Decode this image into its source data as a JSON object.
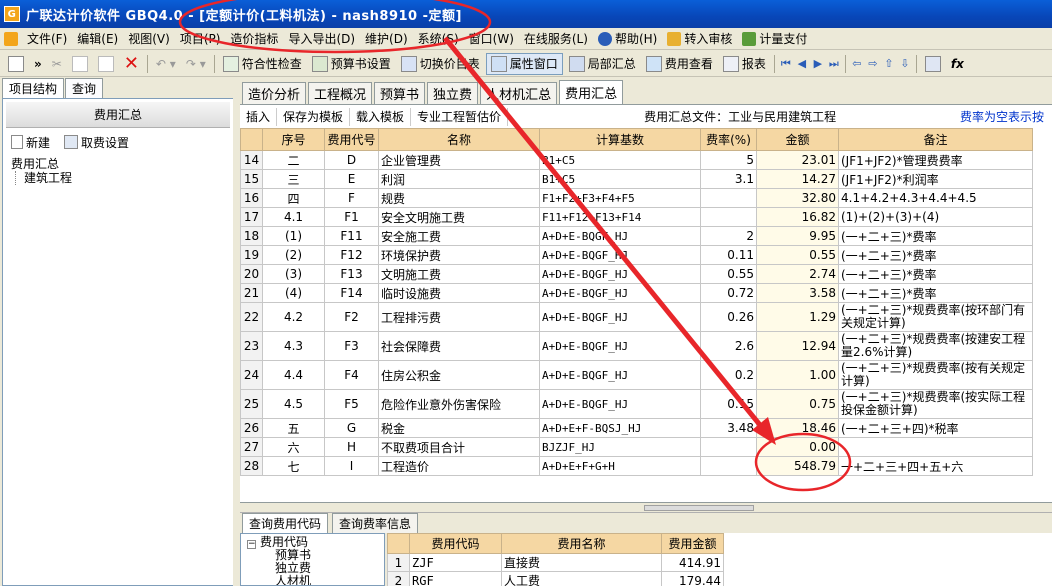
{
  "window": {
    "title": "广联达计价软件 GBQ4.0 - [定额计价(工料机法) - nash8910 -定额]",
    "app_icon": "G"
  },
  "menu": [
    "文件(F)",
    "编辑(E)",
    "视图(V)",
    "项目(P)",
    "造价指标",
    "导入导出(D)",
    "维护(D)",
    "系统(S)",
    "窗口(W)",
    "在线服务(L)",
    "帮助(H)",
    "转入审核",
    "计量支付"
  ],
  "toolbar": {
    "check": "符合性检查",
    "budget_settings": "预算书设置",
    "switch_price": "切换价目表",
    "property_window": "属性窗口",
    "partial_summary": "局部汇总",
    "fee_view": "费用查看",
    "report": "报表"
  },
  "left": {
    "tabs": [
      "项目结构",
      "查询"
    ],
    "header": "费用汇总",
    "new": "新建",
    "fee_settings": "取费设置",
    "tree_root": "费用汇总",
    "tree_child": "建筑工程"
  },
  "main_tabs": [
    "造价分析",
    "工程概况",
    "预算书",
    "独立费",
    "人材机汇总",
    "费用汇总"
  ],
  "subbar": {
    "insert": "插入",
    "save_template": "保存为模板",
    "load_template": "载入模板",
    "estimate": "专业工程暂估价",
    "file_label": "费用汇总文件：工业与民用建筑工程",
    "link": "费率为空表示按"
  },
  "grid": {
    "headers": [
      "序号",
      "费用代号",
      "名称",
      "计算基数",
      "费率(%)",
      "金额",
      "备注"
    ],
    "rows": [
      {
        "n": "14",
        "seq": "二",
        "code": "D",
        "name": "企业管理费",
        "base": "B1+C5",
        "rate": "5",
        "amt": "23.01",
        "note": "(JF1+JF2)*管理费费率"
      },
      {
        "n": "15",
        "seq": "三",
        "code": "E",
        "name": "利润",
        "base": "B1+C5",
        "rate": "3.1",
        "amt": "14.27",
        "note": "(JF1+JF2)*利润率"
      },
      {
        "n": "16",
        "seq": "四",
        "code": "F",
        "name": "规费",
        "base": "F1+F2+F3+F4+F5",
        "rate": "",
        "amt": "32.80",
        "note": "4.1+4.2+4.3+4.4+4.5"
      },
      {
        "n": "17",
        "seq": "4.1",
        "code": "F1",
        "name": "安全文明施工费",
        "base": "F11+F12+F13+F14",
        "rate": "",
        "amt": "16.82",
        "note": "(1)+(2)+(3)+(4)"
      },
      {
        "n": "18",
        "seq": "(1)",
        "code": "F11",
        "name": "安全施工费",
        "base": "A+D+E-BQGF_HJ",
        "rate": "2",
        "amt": "9.95",
        "note": "(一+二+三)*费率"
      },
      {
        "n": "19",
        "seq": "(2)",
        "code": "F12",
        "name": "环境保护费",
        "base": "A+D+E-BQGF_HJ",
        "rate": "0.11",
        "amt": "0.55",
        "note": "(一+二+三)*费率"
      },
      {
        "n": "20",
        "seq": "(3)",
        "code": "F13",
        "name": "文明施工费",
        "base": "A+D+E-BQGF_HJ",
        "rate": "0.55",
        "amt": "2.74",
        "note": "(一+二+三)*费率"
      },
      {
        "n": "21",
        "seq": "(4)",
        "code": "F14",
        "name": "临时设施费",
        "base": "A+D+E-BQGF_HJ",
        "rate": "0.72",
        "amt": "3.58",
        "note": "(一+二+三)*费率"
      },
      {
        "n": "22",
        "seq": "4.2",
        "code": "F2",
        "name": "工程排污费",
        "base": "A+D+E-BQGF_HJ",
        "rate": "0.26",
        "amt": "1.29",
        "note": "(一+二+三)*规费费率(按环部门有关规定计算)",
        "tall": true
      },
      {
        "n": "23",
        "seq": "4.3",
        "code": "F3",
        "name": "社会保障费",
        "base": "A+D+E-BQGF_HJ",
        "rate": "2.6",
        "amt": "12.94",
        "note": "(一+二+三)*规费费率(按建安工程量2.6%计算)",
        "tall": true
      },
      {
        "n": "24",
        "seq": "4.4",
        "code": "F4",
        "name": "住房公积金",
        "base": "A+D+E-BQGF_HJ",
        "rate": "0.2",
        "amt": "1.00",
        "note": "(一+二+三)*规费费率(按有关规定计算)",
        "tall": true
      },
      {
        "n": "25",
        "seq": "4.5",
        "code": "F5",
        "name": "危险作业意外伤害保险",
        "base": "A+D+E-BQGF_HJ",
        "rate": "0.15",
        "amt": "0.75",
        "note": "(一+二+三)*规费费率(按实际工程投保金额计算)",
        "tall": true
      },
      {
        "n": "26",
        "seq": "五",
        "code": "G",
        "name": "税金",
        "base": "A+D+E+F-BQSJ_HJ",
        "rate": "3.48",
        "amt": "18.46",
        "note": "(一+二+三+四)*税率"
      },
      {
        "n": "27",
        "seq": "六",
        "code": "H",
        "name": "不取费项目合计",
        "base": "BJZJF_HJ",
        "rate": "",
        "amt": "0.00",
        "note": ""
      },
      {
        "n": "28",
        "seq": "七",
        "code": "I",
        "name": "工程造价",
        "base": "A+D+E+F+G+H",
        "rate": "",
        "amt": "548.79",
        "note": "一+二+三+四+五+六"
      }
    ]
  },
  "bottom": {
    "tabs": [
      "查询费用代码",
      "查询费率信息"
    ],
    "tree_root": "费用代码",
    "tree_children": [
      "预算书",
      "独立费",
      "人材机"
    ],
    "headers": [
      "费用代码",
      "费用名称",
      "费用金额"
    ],
    "rows": [
      {
        "n": "1",
        "code": "ZJF",
        "name": "直接费",
        "amt": "414.91"
      },
      {
        "n": "2",
        "code": "RGF",
        "name": "人工费",
        "amt": "179.44"
      }
    ]
  },
  "colors": {
    "annotation": "#e8262a",
    "header_fill": "#f5d7a3",
    "title_bar": "#0a5fd8"
  }
}
